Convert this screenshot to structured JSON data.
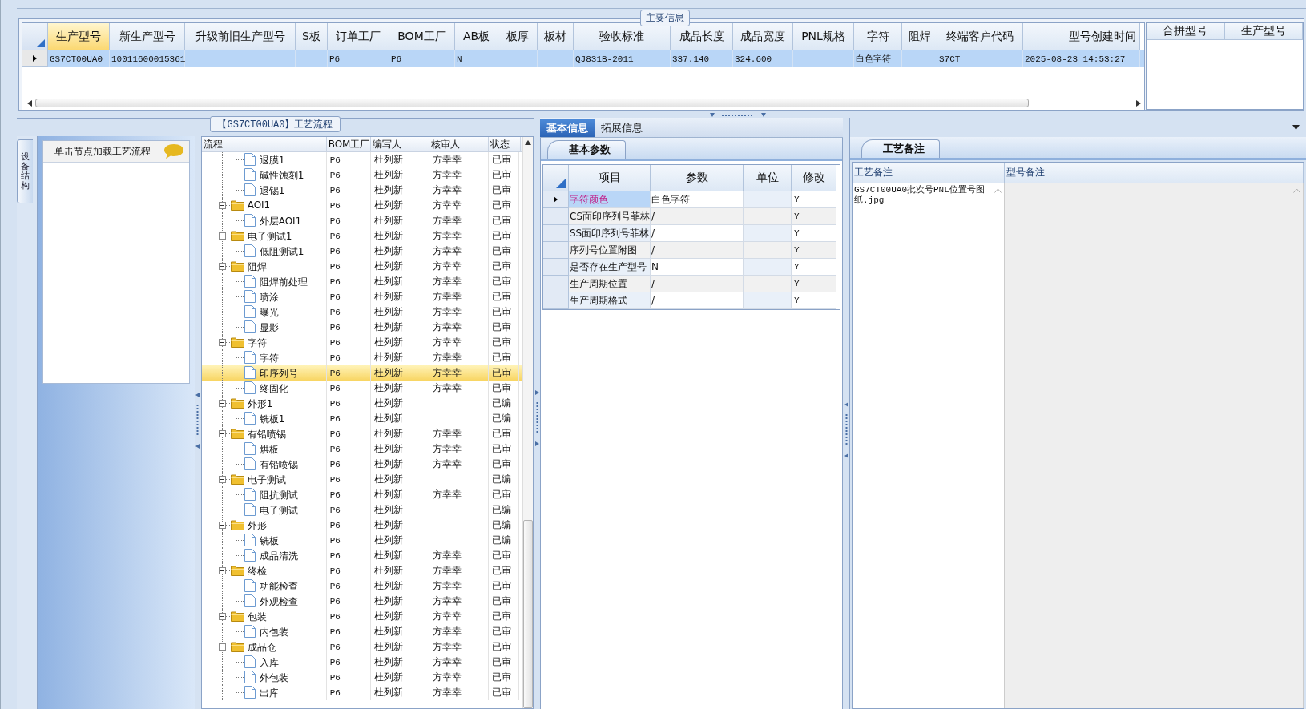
{
  "main_info": {
    "legend": "主要信息",
    "columns": [
      {
        "label": "生产型号",
        "selected": true
      },
      {
        "label": "新生产型号",
        "selected": false
      },
      {
        "label": "升级前旧生产型号",
        "selected": false
      },
      {
        "label": "S板",
        "selected": false
      },
      {
        "label": "订单工厂",
        "selected": false
      },
      {
        "label": "BOM工厂",
        "selected": false
      },
      {
        "label": "AB板",
        "selected": false
      },
      {
        "label": "板厚",
        "selected": false
      },
      {
        "label": "板材",
        "selected": false
      },
      {
        "label": "验收标准",
        "selected": false
      },
      {
        "label": "成品长度",
        "selected": false
      },
      {
        "label": "成品宽度",
        "selected": false
      },
      {
        "label": "PNL规格",
        "selected": false
      },
      {
        "label": "字符",
        "selected": false
      },
      {
        "label": "阻焊",
        "selected": false
      },
      {
        "label": "终端客户代码",
        "selected": false
      },
      {
        "label": "型号创建时间",
        "selected": false
      }
    ],
    "rows": [
      {
        "selected": true,
        "cells": [
          "GS7CT00UA0",
          "10011600015361",
          null,
          null,
          "P6",
          "P6",
          "N",
          null,
          null,
          "QJ831B-2011",
          "337.140",
          "324.600",
          null,
          "白色字符",
          null,
          "S7CT",
          "2025-08-23 14:53:27"
        ]
      }
    ],
    "merge_columns": [
      "合拼型号",
      "生产型号"
    ]
  },
  "process": {
    "legend": "【GS7CT00UA0】工艺流程",
    "side_tab": "设备结构",
    "hint": "单击节点加载工艺流程",
    "columns": [
      "流程",
      "BOM工厂",
      "编写人",
      "核审人",
      "状态"
    ],
    "leading_steps": [
      {
        "name": "退膜1",
        "bom": "P6",
        "writer": "杜列新",
        "reviewer": "方幸幸",
        "status": "已审",
        "selected": false
      },
      {
        "name": "碱性蚀刻1",
        "bom": "P6",
        "writer": "杜列新",
        "reviewer": "方幸幸",
        "status": "已审",
        "selected": false
      },
      {
        "name": "退锡1",
        "bom": "P6",
        "writer": "杜列新",
        "reviewer": "方幸幸",
        "status": "已审",
        "selected": false
      }
    ],
    "groups": [
      {
        "name": "AOI1",
        "bom": "P6",
        "writer": "杜列新",
        "reviewer": "方幸幸",
        "status": "已审",
        "selected": false,
        "expanded": true,
        "children": [
          {
            "name": "外层AOI1",
            "bom": "P6",
            "writer": "杜列新",
            "reviewer": "方幸幸",
            "status": "已审",
            "selected": false
          }
        ]
      },
      {
        "name": "电子测试1",
        "bom": "P6",
        "writer": "杜列新",
        "reviewer": "方幸幸",
        "status": "已审",
        "selected": false,
        "expanded": true,
        "children": [
          {
            "name": "低阻测试1",
            "bom": "P6",
            "writer": "杜列新",
            "reviewer": "方幸幸",
            "status": "已审",
            "selected": false
          }
        ]
      },
      {
        "name": "阻焊",
        "bom": "P6",
        "writer": "杜列新",
        "reviewer": "方幸幸",
        "status": "已审",
        "selected": false,
        "expanded": true,
        "children": [
          {
            "name": "阻焊前处理",
            "bom": "P6",
            "writer": "杜列新",
            "reviewer": "方幸幸",
            "status": "已审",
            "selected": false
          },
          {
            "name": "喷涂",
            "bom": "P6",
            "writer": "杜列新",
            "reviewer": "方幸幸",
            "status": "已审",
            "selected": false
          },
          {
            "name": "曝光",
            "bom": "P6",
            "writer": "杜列新",
            "reviewer": "方幸幸",
            "status": "已审",
            "selected": false
          },
          {
            "name": "显影",
            "bom": "P6",
            "writer": "杜列新",
            "reviewer": "方幸幸",
            "status": "已审",
            "selected": false
          }
        ]
      },
      {
        "name": "字符",
        "bom": "P6",
        "writer": "杜列新",
        "reviewer": "方幸幸",
        "status": "已审",
        "selected": false,
        "expanded": true,
        "children": [
          {
            "name": "字符",
            "bom": "P6",
            "writer": "杜列新",
            "reviewer": "方幸幸",
            "status": "已审",
            "selected": false
          },
          {
            "name": "印序列号",
            "bom": "P6",
            "writer": "杜列新",
            "reviewer": "方幸幸",
            "status": "已审",
            "selected": true
          },
          {
            "name": "终固化",
            "bom": "P6",
            "writer": "杜列新",
            "reviewer": "方幸幸",
            "status": "已审",
            "selected": false
          }
        ]
      },
      {
        "name": "外形1",
        "bom": "P6",
        "writer": "杜列新",
        "status": "已编",
        "selected": false,
        "expanded": true,
        "children": [
          {
            "name": "铣板1",
            "bom": "P6",
            "writer": "杜列新",
            "status": "已编",
            "selected": false
          }
        ]
      },
      {
        "name": "有铅喷锡",
        "bom": "P6",
        "writer": "杜列新",
        "reviewer": "方幸幸",
        "status": "已审",
        "selected": false,
        "expanded": true,
        "children": [
          {
            "name": "烘板",
            "bom": "P6",
            "writer": "杜列新",
            "reviewer": "方幸幸",
            "status": "已审",
            "selected": false
          },
          {
            "name": "有铅喷锡",
            "bom": "P6",
            "writer": "杜列新",
            "reviewer": "方幸幸",
            "status": "已审",
            "selected": false
          }
        ]
      },
      {
        "name": "电子测试",
        "bom": "P6",
        "writer": "杜列新",
        "status": "已编",
        "selected": false,
        "expanded": true,
        "children": [
          {
            "name": "阻抗测试",
            "bom": "P6",
            "writer": "杜列新",
            "reviewer": "方幸幸",
            "status": "已审",
            "selected": false
          },
          {
            "name": "电子测试",
            "bom": "P6",
            "writer": "杜列新",
            "status": "已编",
            "selected": false
          }
        ]
      },
      {
        "name": "外形",
        "bom": "P6",
        "writer": "杜列新",
        "status": "已编",
        "selected": false,
        "expanded": true,
        "children": [
          {
            "name": "铣板",
            "bom": "P6",
            "writer": "杜列新",
            "status": "已编",
            "selected": false
          },
          {
            "name": "成品清洗",
            "bom": "P6",
            "writer": "杜列新",
            "reviewer": "方幸幸",
            "status": "已审",
            "selected": false
          }
        ]
      },
      {
        "name": "终检",
        "bom": "P6",
        "writer": "杜列新",
        "reviewer": "方幸幸",
        "status": "已审",
        "selected": false,
        "expanded": true,
        "children": [
          {
            "name": "功能检查",
            "bom": "P6",
            "writer": "杜列新",
            "reviewer": "方幸幸",
            "status": "已审",
            "selected": false
          },
          {
            "name": "外观检查",
            "bom": "P6",
            "writer": "杜列新",
            "reviewer": "方幸幸",
            "status": "已审",
            "selected": false
          }
        ]
      },
      {
        "name": "包装",
        "bom": "P6",
        "writer": "杜列新",
        "reviewer": "方幸幸",
        "status": "已审",
        "selected": false,
        "expanded": true,
        "children": [
          {
            "name": "内包装",
            "bom": "P6",
            "writer": "杜列新",
            "reviewer": "方幸幸",
            "status": "已审",
            "selected": false
          }
        ]
      },
      {
        "name": "成品仓",
        "bom": "P6",
        "writer": "杜列新",
        "reviewer": "方幸幸",
        "status": "已审",
        "selected": false,
        "expanded": true,
        "children": [
          {
            "name": "入库",
            "bom": "P6",
            "writer": "杜列新",
            "reviewer": "方幸幸",
            "status": "已审",
            "selected": false
          },
          {
            "name": "外包装",
            "bom": "P6",
            "writer": "杜列新",
            "reviewer": "方幸幸",
            "status": "已审",
            "selected": false
          },
          {
            "name": "出库",
            "bom": "P6",
            "writer": "杜列新",
            "reviewer": "方幸幸",
            "status": "已审",
            "selected": false
          }
        ]
      }
    ]
  },
  "info_tabs": [
    {
      "label": "基本信息",
      "selected": true
    },
    {
      "label": "拓展信息",
      "selected": false
    }
  ],
  "basic_params": {
    "tab": "基本参数",
    "columns": [
      "项目",
      "参数",
      "单位",
      "修改"
    ],
    "rows": [
      {
        "item": "字符颜色",
        "param": "白色字符",
        "modify": "Y",
        "selected": true
      },
      {
        "item": "CS面印序列号菲林",
        "param": "/",
        "modify": "Y",
        "selected": false
      },
      {
        "item": "SS面印序列号菲林",
        "param": "/",
        "modify": "Y",
        "selected": false
      },
      {
        "item": "序列号位置附图",
        "param": "/",
        "modify": "Y",
        "selected": false
      },
      {
        "item": "是否存在生产型号",
        "param": "N",
        "modify": "Y",
        "selected": false
      },
      {
        "item": "生产周期位置",
        "param": "/",
        "modify": "Y",
        "selected": false
      },
      {
        "item": "生产周期格式",
        "param": "/",
        "modify": "Y",
        "selected": false
      }
    ]
  },
  "remarks": {
    "tab": "工艺备注",
    "columns": [
      "工艺备注",
      "型号备注"
    ],
    "process_remark": "GS7CT00UA0批次号PNL位置号图纸.jpg"
  }
}
